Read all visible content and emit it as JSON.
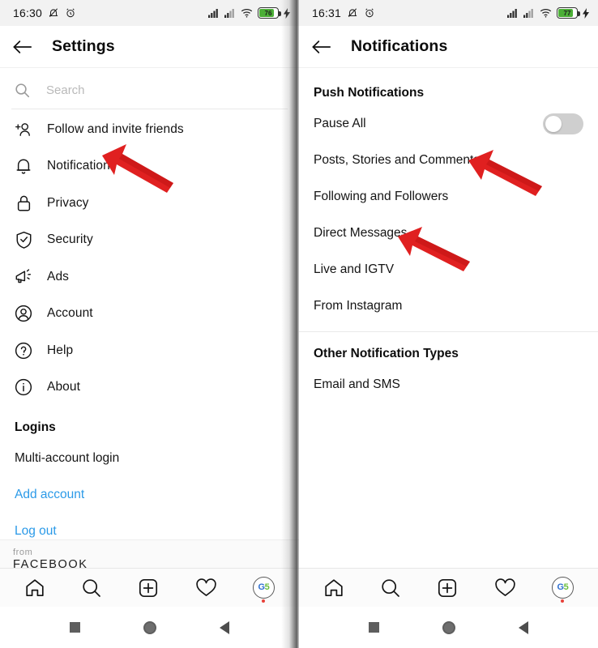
{
  "left_panel": {
    "status_bar": {
      "time": "16:30",
      "icons": [
        "bell-muted-icon",
        "alarm-icon",
        "signal-1-icon",
        "signal-2-icon",
        "wifi-icon",
        "battery-icon",
        "charging-bolt-icon"
      ],
      "battery_level": "76"
    },
    "top_bar": {
      "back_icon": "back-arrow-icon",
      "title": "Settings"
    },
    "search": {
      "icon": "search-icon",
      "placeholder": "Search"
    },
    "items": [
      {
        "icon": "add-person-icon",
        "label": "Follow and invite friends"
      },
      {
        "icon": "bell-icon",
        "label": "Notifications"
      },
      {
        "icon": "lock-icon",
        "label": "Privacy"
      },
      {
        "icon": "shield-check-icon",
        "label": "Security"
      },
      {
        "icon": "megaphone-icon",
        "label": "Ads"
      },
      {
        "icon": "account-circle-icon",
        "label": "Account"
      },
      {
        "icon": "help-circle-icon",
        "label": "Help"
      },
      {
        "icon": "info-circle-icon",
        "label": "About"
      }
    ],
    "logins_section": {
      "title": "Logins",
      "items": [
        {
          "label": "Multi-account login",
          "link": false
        },
        {
          "label": "Add account",
          "link": true
        },
        {
          "label": "Log out",
          "link": true
        }
      ]
    },
    "footer": {
      "from": "from",
      "brand": "FACEBOOK"
    }
  },
  "right_panel": {
    "status_bar": {
      "time": "16:31",
      "battery_level": "77"
    },
    "top_bar": {
      "back_icon": "back-arrow-icon",
      "title": "Notifications"
    },
    "push_section": {
      "title": "Push Notifications",
      "pause_all": {
        "label": "Pause All",
        "enabled": false
      },
      "items": [
        {
          "label": "Posts, Stories and Comments"
        },
        {
          "label": "Following and Followers"
        },
        {
          "label": "Direct Messages"
        },
        {
          "label": "Live and IGTV"
        },
        {
          "label": "From Instagram"
        }
      ]
    },
    "other_section": {
      "title": "Other Notification Types",
      "items": [
        {
          "label": "Email and SMS"
        }
      ]
    }
  },
  "bottom_nav": {
    "items": [
      {
        "icon": "home-icon"
      },
      {
        "icon": "search-icon"
      },
      {
        "icon": "add-post-icon"
      },
      {
        "icon": "heart-icon"
      },
      {
        "icon": "profile-avatar-icon"
      }
    ],
    "avatar_text_blue": "G",
    "avatar_text_green": "5"
  },
  "system_nav": {
    "items": [
      {
        "icon": "recents-square-icon"
      },
      {
        "icon": "home-circle-icon"
      },
      {
        "icon": "back-triangle-icon"
      }
    ]
  },
  "annotations": {
    "accent_color": "#e02020",
    "arrows": [
      {
        "name": "arrow-to-notifications",
        "target": "Notifications"
      },
      {
        "name": "arrow-to-posts-stories-comments",
        "target": "Posts, Stories and Comments"
      },
      {
        "name": "arrow-to-direct-messages",
        "target": "Direct Messages"
      }
    ]
  }
}
